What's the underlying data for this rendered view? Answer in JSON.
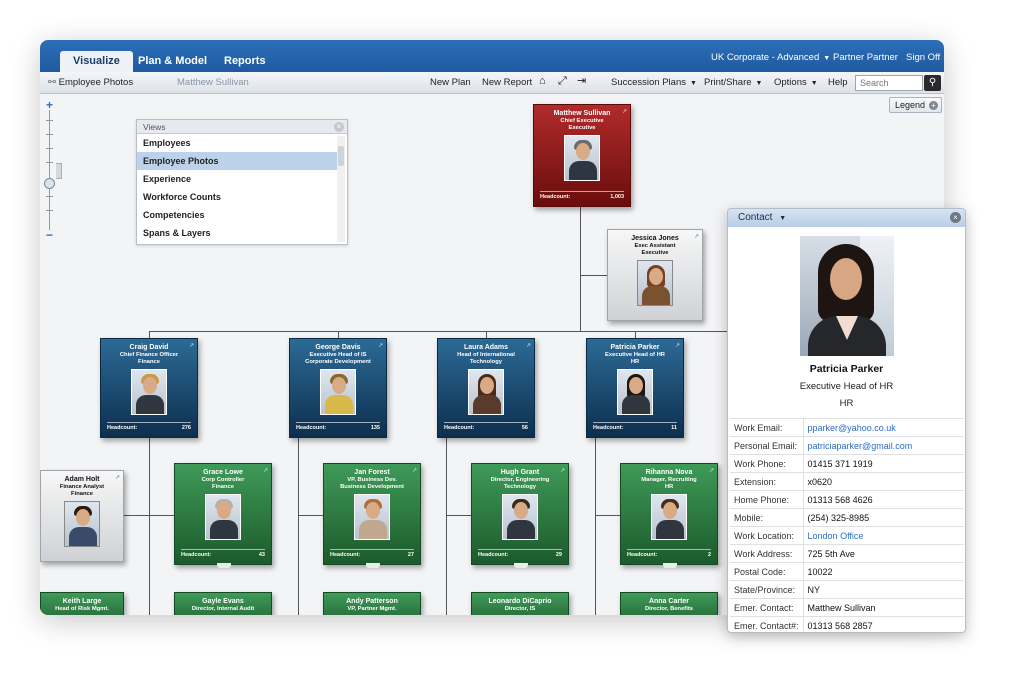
{
  "nav": {
    "tabs": [
      {
        "label": "Visualize",
        "active": true
      },
      {
        "label": "Plan & Model",
        "active": false
      },
      {
        "label": "Reports",
        "active": false
      }
    ],
    "org_selector": "UK Corporate - Advanced",
    "user": "Partner Partner",
    "signoff": "Sign Off"
  },
  "toolbar": {
    "view_name": "Employee Photos",
    "crumb": "Matthew Sullivan",
    "new_plan": "New Plan",
    "new_report": "New Report",
    "succession": "Succession Plans",
    "print_share": "Print/Share",
    "options": "Options",
    "help": "Help",
    "search_placeholder": "Search"
  },
  "legend": {
    "label": "Legend"
  },
  "views_panel": {
    "title": "Views",
    "items": [
      "Employees",
      "Employee Photos",
      "Experience",
      "Workforce Counts",
      "Competencies",
      "Spans & Layers"
    ],
    "selected": "Employee Photos"
  },
  "org": {
    "headcount_label": "Headcount:",
    "ceo": {
      "name": "Matthew Sullivan",
      "title": "Chief Executive",
      "dept": "Executive",
      "headcount": "1,003"
    },
    "assistant": {
      "name": "Jessica Jones",
      "title": "Exec Assistant",
      "dept": "Executive"
    },
    "level2": [
      {
        "name": "Craig David",
        "title": "Chief Finance Officer",
        "dept": "Finance",
        "headcount": "276"
      },
      {
        "name": "George Davis",
        "title": "Executive Head of IS",
        "dept": "Corporate Development",
        "headcount": "135"
      },
      {
        "name": "Laura Adams",
        "title": "Head of International",
        "dept": "Technology",
        "headcount": "56"
      },
      {
        "name": "Patricia Parker",
        "title": "Executive Head of HR",
        "dept": "HR",
        "headcount": "11"
      }
    ],
    "adam": {
      "name": "Adam Holt",
      "title": "Finance Analyst",
      "dept": "Finance"
    },
    "level3": [
      {
        "name": "Grace Lowe",
        "title": "Corp Controller",
        "dept": "Finance",
        "headcount": "43"
      },
      {
        "name": "Jan Forest",
        "title": "VP, Business Dev.",
        "dept": "Business Development",
        "headcount": "27"
      },
      {
        "name": "Hugh Grant",
        "title": "Director, Engineering",
        "dept": "Technology",
        "headcount": "29"
      },
      {
        "name": "Rihanna Nova",
        "title": "Manager, Recruiting",
        "dept": "HR",
        "headcount": "2"
      }
    ],
    "level4": [
      {
        "name": "Keith Large",
        "title": "Head of Risk Mgmt."
      },
      {
        "name": "Gayle Evans",
        "title": "Director, Internal Audit"
      },
      {
        "name": "Andy Patterson",
        "title": "VP, Partner Mgmt."
      },
      {
        "name": "Leonardo DiCaprio",
        "title": "Director, IS"
      },
      {
        "name": "Anna Carter",
        "title": "Director, Benefits"
      }
    ]
  },
  "contact": {
    "header": "Contact",
    "name": "Patricia Parker",
    "title": "Executive Head of HR",
    "dept": "HR",
    "rows": [
      {
        "label": "Work Email:",
        "value": "pparker@yahoo.co.uk",
        "link": true
      },
      {
        "label": "Personal Email:",
        "value": "patriciaparker@gmail.com",
        "link": true
      },
      {
        "label": "Work Phone:",
        "value": "01415 371 1919",
        "link": false
      },
      {
        "label": "Extension:",
        "value": "x0620",
        "link": false
      },
      {
        "label": "Home Phone:",
        "value": "01313 568 4626",
        "link": false
      },
      {
        "label": "Mobile:",
        "value": "(254) 325-8985",
        "link": false
      },
      {
        "label": "Work Location:",
        "value": "London Office",
        "link": true
      },
      {
        "label": "Work Address:",
        "value": "725 5th Ave",
        "link": false
      },
      {
        "label": "Postal Code:",
        "value": "10022",
        "link": false
      },
      {
        "label": "State/Province:",
        "value": "NY",
        "link": false
      },
      {
        "label": "Emer. Contact:",
        "value": "Matthew Sullivan",
        "link": false
      },
      {
        "label": "Emer. Contact#:",
        "value": "01313 568 2857",
        "link": false
      }
    ]
  },
  "colors": {
    "nav_blue": "#1f5aa0",
    "ceo_red": "#8e1a1a",
    "exec_blue": "#1a4a72",
    "team_green": "#2e7a45",
    "link_blue": "#2a6cc8"
  }
}
